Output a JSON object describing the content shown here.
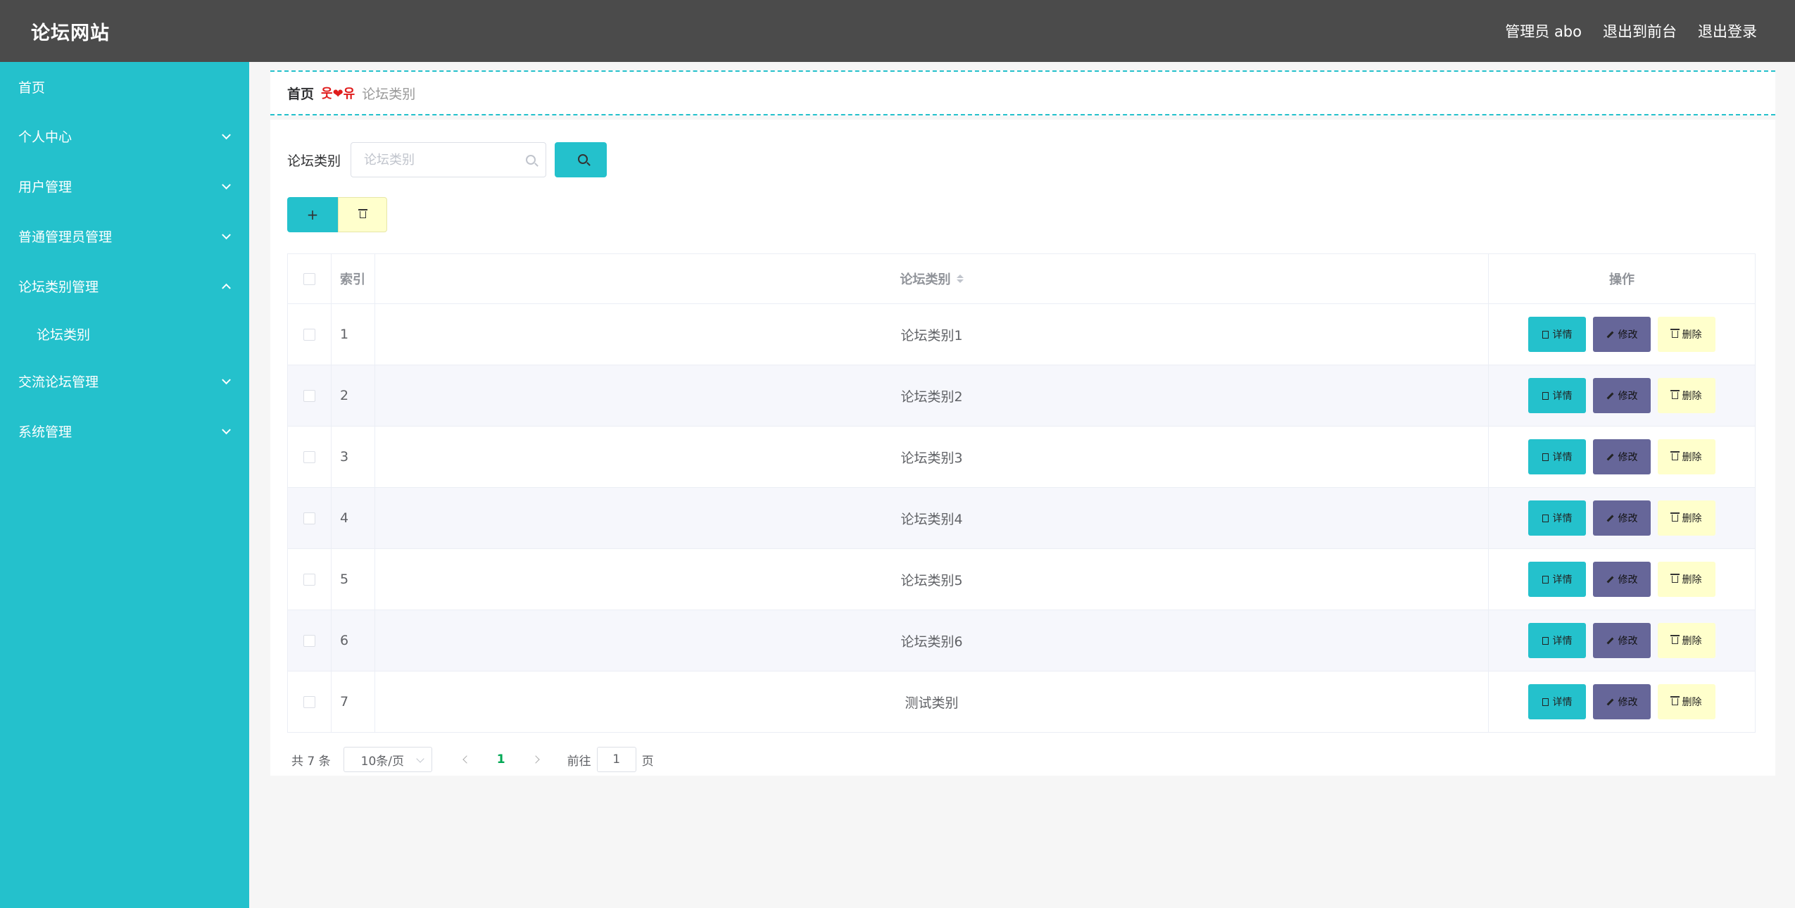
{
  "header": {
    "brand": "论坛网站",
    "admin_label": "管理员 abo",
    "to_front": "退出到前台",
    "logout": "退出登录"
  },
  "sidebar": {
    "items": [
      {
        "label": "首页",
        "has_children": false
      },
      {
        "label": "个人中心",
        "has_children": true,
        "expanded": false
      },
      {
        "label": "用户管理",
        "has_children": true,
        "expanded": false
      },
      {
        "label": "普通管理员管理",
        "has_children": true,
        "expanded": false
      },
      {
        "label": "论坛类别管理",
        "has_children": true,
        "expanded": true
      },
      {
        "label": "论坛类别",
        "submenu": true,
        "active": true
      },
      {
        "label": "交流论坛管理",
        "has_children": true,
        "expanded": false
      },
      {
        "label": "系统管理",
        "has_children": true,
        "expanded": false
      }
    ]
  },
  "breadcrumb": {
    "home": "首页",
    "separator": "웃❤유",
    "current": "论坛类别"
  },
  "search": {
    "label": "论坛类别",
    "placeholder": "论坛类别",
    "value": ""
  },
  "table": {
    "headers": {
      "index": "索引",
      "name": "论坛类别",
      "ops": "操作"
    },
    "rows": [
      {
        "index": "1",
        "name": "论坛类别1"
      },
      {
        "index": "2",
        "name": "论坛类别2"
      },
      {
        "index": "3",
        "name": "论坛类别3"
      },
      {
        "index": "4",
        "name": "论坛类别4"
      },
      {
        "index": "5",
        "name": "论坛类别5"
      },
      {
        "index": "6",
        "name": "论坛类别6"
      },
      {
        "index": "7",
        "name": "测试类别"
      }
    ],
    "ops": {
      "detail": "详情",
      "edit": "修改",
      "delete": "删除"
    }
  },
  "pagination": {
    "total": "共 7 条",
    "page_size": "10条/页",
    "current": "1",
    "goto_prefix": "前往",
    "goto_value": "1",
    "goto_suffix": "页"
  },
  "colors": {
    "header_bg": "#4b4b4b",
    "sidebar_bg": "#24c1cc",
    "detail_btn": "#24c1cc",
    "edit_btn": "#666699",
    "delete_btn": "#ffffcc",
    "active_page": "#00a854"
  }
}
